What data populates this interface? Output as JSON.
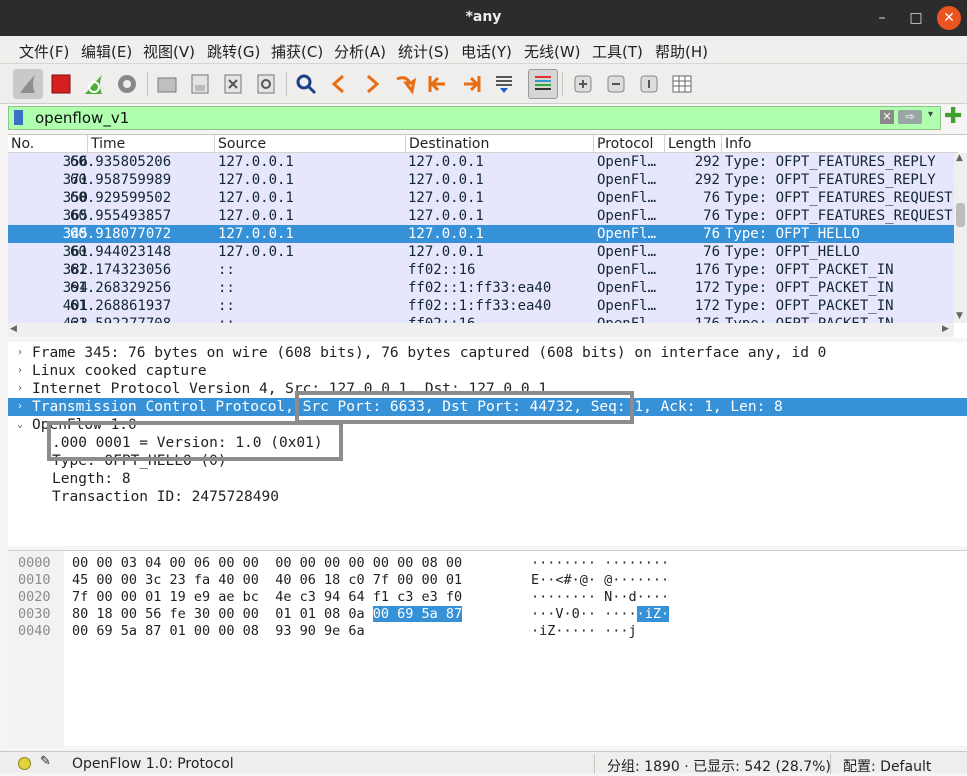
{
  "window": {
    "title": "*any",
    "minimize": "–",
    "maximize": "□",
    "close": "✕"
  },
  "menu": [
    "文件(F)",
    "编辑(E)",
    "视图(V)",
    "跳转(G)",
    "捕获(C)",
    "分析(A)",
    "统计(S)",
    "电话(Y)",
    "无线(W)",
    "工具(T)",
    "帮助(H)"
  ],
  "toolbar": {
    "icons": [
      "shark-fin-start-icon",
      "stop-capture-icon",
      "restart-capture-icon",
      "capture-options-gear-icon",
      "open-file-icon",
      "save-file-icon",
      "close-file-icon",
      "reload-file-icon",
      "find-packet-icon",
      "go-back-icon",
      "go-forward-icon",
      "go-to-packet-icon",
      "go-first-icon",
      "go-last-icon",
      "autoscroll-icon",
      "colorize-icon",
      "zoom-in-icon",
      "zoom-out-icon",
      "normal-size-icon",
      "resize-columns-icon"
    ]
  },
  "filter": {
    "value": "openflow_v1",
    "clear": "✕",
    "apply": "⇨",
    "dropdown": "▾",
    "add": "✚"
  },
  "packet_list": {
    "columns": [
      "No.",
      "Time",
      "Source",
      "Destination",
      "Protocol",
      "Length",
      "Info"
    ],
    "rows": [
      {
        "no": "356",
        "time": "60.935805206",
        "src": "127.0.0.1",
        "dst": "127.0.0.1",
        "proto": "OpenFl…",
        "len": "292",
        "info": "Type: OFPT_FEATURES_REPLY"
      },
      {
        "no": "371",
        "time": "60.958759989",
        "src": "127.0.0.1",
        "dst": "127.0.0.1",
        "proto": "OpenFl…",
        "len": "292",
        "info": "Type: OFPT_FEATURES_REPLY"
      },
      {
        "no": "350",
        "time": "60.929599502",
        "src": "127.0.0.1",
        "dst": "127.0.0.1",
        "proto": "OpenFl…",
        "len": "76",
        "info": "Type: OFPT_FEATURES_REQUEST"
      },
      {
        "no": "365",
        "time": "60.955493857",
        "src": "127.0.0.1",
        "dst": "127.0.0.1",
        "proto": "OpenFl…",
        "len": "76",
        "info": "Type: OFPT_FEATURES_REQUEST"
      },
      {
        "no": "345",
        "time": "60.918077072",
        "src": "127.0.0.1",
        "dst": "127.0.0.1",
        "proto": "OpenFl…",
        "len": "76",
        "info": "Type: OFPT_HELLO"
      },
      {
        "no": "361",
        "time": "60.944023148",
        "src": "127.0.0.1",
        "dst": "127.0.0.1",
        "proto": "OpenFl…",
        "len": "76",
        "info": "Type: OFPT_HELLO"
      },
      {
        "no": "382",
        "time": "61.174323056",
        "src": "::",
        "dst": "ff02::16",
        "proto": "OpenFl…",
        "len": "176",
        "info": "Type: OFPT_PACKET_IN"
      },
      {
        "no": "394",
        "time": "61.268329256",
        "src": "::",
        "dst": "ff02::1:ff33:ea40",
        "proto": "OpenFl…",
        "len": "172",
        "info": "Type: OFPT_PACKET_IN"
      },
      {
        "no": "401",
        "time": "61.268861937",
        "src": "::",
        "dst": "ff02::1:ff33:ea40",
        "proto": "OpenFl…",
        "len": "172",
        "info": "Type: OFPT_PACKET_IN"
      },
      {
        "no": "433",
        "time": "61.592277708",
        "src": "::",
        "dst": "ff02::16",
        "proto": "OpenFl…",
        "len": "176",
        "info": "Type: OFPT_PACKET_IN"
      }
    ],
    "selected_no": "345"
  },
  "details": {
    "rows": [
      {
        "text": "Frame 345: 76 bytes on wire (608 bits), 76 bytes captured (608 bits) on interface any, id 0",
        "expander": "›"
      },
      {
        "text": "Linux cooked capture",
        "expander": "›"
      },
      {
        "text": "Internet Protocol Version 4, Src: 127.0.0.1, Dst: 127.0.0.1",
        "expander": "›"
      },
      {
        "text": "Transmission Control Protocol, Src Port: 6633, Dst Port: 44732, Seq: 1, Ack: 1, Len: 8",
        "expander": "›"
      },
      {
        "text": "OpenFlow 1.0",
        "expander": "⌄"
      },
      {
        "text": ".000 0001 = Version: 1.0 (0x01)",
        "expander": ""
      },
      {
        "text": "Type: OFPT_HELLO (0)",
        "expander": ""
      },
      {
        "text": "Length: 8",
        "expander": ""
      },
      {
        "text": "Transaction ID: 2475728490",
        "expander": ""
      }
    ]
  },
  "bytes": {
    "rows": [
      {
        "offset": "0000",
        "hex_a": "00 00 03 04 00 06 00 00  00 00 00 00 00 00 08 00",
        "hex_hl": "",
        "ascii_a": "········ ········",
        "ascii_hl": ""
      },
      {
        "offset": "0010",
        "hex_a": "45 00 00 3c 23 fa 40 00  40 06 18 c0 7f 00 00 01",
        "hex_hl": "",
        "ascii_a": "E··<#·@· @·······",
        "ascii_hl": ""
      },
      {
        "offset": "0020",
        "hex_a": "7f 00 00 01 19 e9 ae bc  4e c3 94 64 f1 c3 e3 f0",
        "hex_hl": "",
        "ascii_a": "········ N··d····",
        "ascii_hl": ""
      },
      {
        "offset": "0030",
        "hex_a": "80 18 00 56 fe 30 00 00  01 01 08 0a ",
        "hex_hl": "00 69 5a 87",
        "ascii_a": "···V·0·· ····",
        "ascii_hl": "·iZ·"
      },
      {
        "offset": "0040",
        "hex_a": "00 69 5a 87 01 00 00 08  93 90 9e 6a",
        "hex_hl": "",
        "ascii_a": "·iZ····· ···j",
        "ascii_hl": ""
      }
    ]
  },
  "status": {
    "text": "OpenFlow 1.0: Protocol",
    "packets": "分组: 1890 · 已显示: 542 (28.7%)",
    "profile": "配置: Default"
  },
  "colors": {
    "row_bg": "#e7e6ff",
    "selected": "#3791d7",
    "filter_ok": "#afffaf",
    "annotation_box": "#8c8c8c"
  }
}
